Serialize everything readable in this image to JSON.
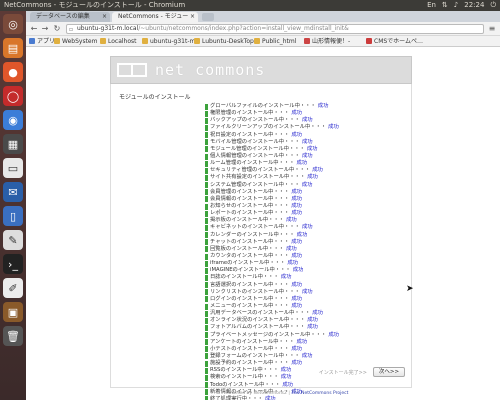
{
  "os": {
    "window_title": "NetCommons - モジュールのインストール - Chromium",
    "tray": {
      "keyboard": "En",
      "time": "22:24"
    },
    "launcher_icons": [
      "dash-icon",
      "files-icon",
      "firefox-icon",
      "red-app-icon",
      "chromium-icon",
      "calendar-icon",
      "document-icon",
      "thunderbird-icon",
      "writer-icon",
      "terminal-icon",
      "editor-icon",
      "trash-icon"
    ]
  },
  "browser": {
    "tabs": [
      {
        "label": "データベースの編集"
      },
      {
        "label": "NetCommons - モジュー"
      }
    ],
    "url_host": "ubuntu-g31t-m.local",
    "url_rest": "/~ubuntu/netcommons/index.php?action=install_view_mdinstall_init&",
    "bookmarks": [
      "アプリ",
      "WebSystem",
      "Localhost",
      "ubuntu-g31t-m",
      "Lubuntu-DeskTop",
      "Public_html",
      "山形情報便！-",
      "CMSでホームペ…"
    ]
  },
  "page": {
    "logo_text": "net commons",
    "heading": "モジュールのインストール",
    "modules": [
      "グローバルファイルのインストール中・・・",
      "権限管理のインストール中・・・",
      "バックアップのインストール中・・・",
      "ファイルクリーンアップのインストール中・・・",
      "祝日設定のインストール中・・・",
      "モバイル管理のインストール中・・・",
      "モジュール管理のインストール中・・・",
      "個人情報管理のインストール中・・・",
      "ルーム管理のインストール中・・・",
      "セキュリティ管理のインストール中・・・",
      "サイト共有設定のインストール中・・・",
      "システム管理のインストール中・・・",
      "会員管理のインストール中・・・",
      "会員情報のインストール中・・・",
      "お知らせのインストール中・・・",
      "レポートのインストール中・・・",
      "掲示板のインストール中・・・",
      "キャビネットのインストール中・・・",
      "カレンダーのインストール中・・・",
      "チャットのインストール中・・・",
      "回覧板のインストール中・・・",
      "カウンタのインストール中・・・",
      "iframeのインストール中・・・",
      "iMAGINEのインストール中・・・",
      "日誌のインストール中・・・",
      "言語選択のインストール中・・・",
      "リンクリストのインストール中・・・",
      "ログインのインストール中・・・",
      "メニューのインストール中・・・",
      "汎用データベースのインストール中・・・",
      "オンライン状況のインストール中・・・",
      "フォトアルバムのインストール中・・・",
      "プライベートメッセージのインストール中・・・",
      "アンケートのインストール中・・・",
      "小テストのインストール中・・・",
      "登録フォームのインストール中・・・",
      "施設予約のインストール中・・・",
      "RSSのインストール中・・・",
      "検索のインストール中・・・",
      "Todoのインストール中・・・",
      "新着情報のインストール中・・・",
      "終了処理実行中・・・"
    ],
    "status_ok": "成功",
    "footer_label": "インストール完了>>",
    "next_button": "次へ>>",
    "powered_prefix": "Powered by NetCommons2",
    "powered_link": "The NetCommons Project"
  },
  "colors": {
    "success_mark": "#3ca23c",
    "success_text": "#1a1acc",
    "titlebar": "#3c3b37"
  }
}
